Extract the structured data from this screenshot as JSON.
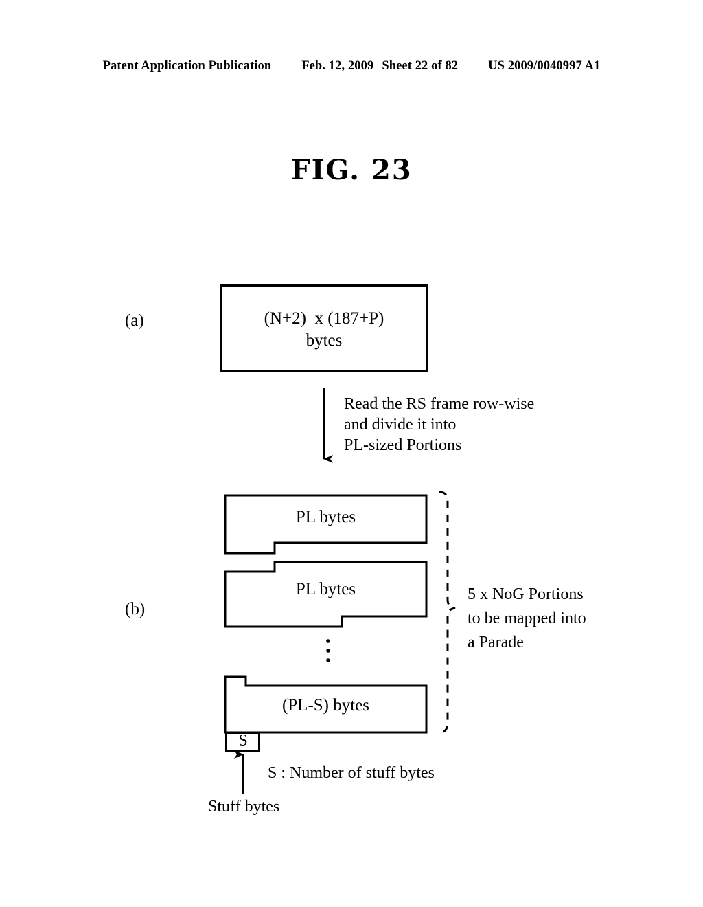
{
  "header": {
    "publication": "Patent Application Publication",
    "date": "Feb. 12, 2009",
    "sheet": "Sheet 22 of 82",
    "patent_number": "US 2009/0040997 A1"
  },
  "figure": {
    "title": "FIG. 23",
    "part_a_label": "(a)",
    "part_b_label": "(b)",
    "box_a": {
      "line1": "(N+2)  x (187+P)",
      "line2": "bytes"
    },
    "arrow_note": {
      "line1": "Read the RS frame row-wise",
      "line2": "and divide it into",
      "line3": "PL-sized Portions"
    },
    "portions": [
      {
        "label": "PL bytes"
      },
      {
        "label": "PL bytes"
      },
      {
        "label": "(PL-S) bytes"
      }
    ],
    "ellipsis": "⋮",
    "stuff_box_label": "S",
    "brace_note": {
      "line1": "5 x NoG Portions",
      "line2": "to be mapped into",
      "line3": "a Parade"
    },
    "stuff_definition": "S : Number of stuff bytes",
    "stuff_arrow_label": "Stuff bytes"
  },
  "colors": {
    "ink": "#000000",
    "page": "#ffffff"
  }
}
